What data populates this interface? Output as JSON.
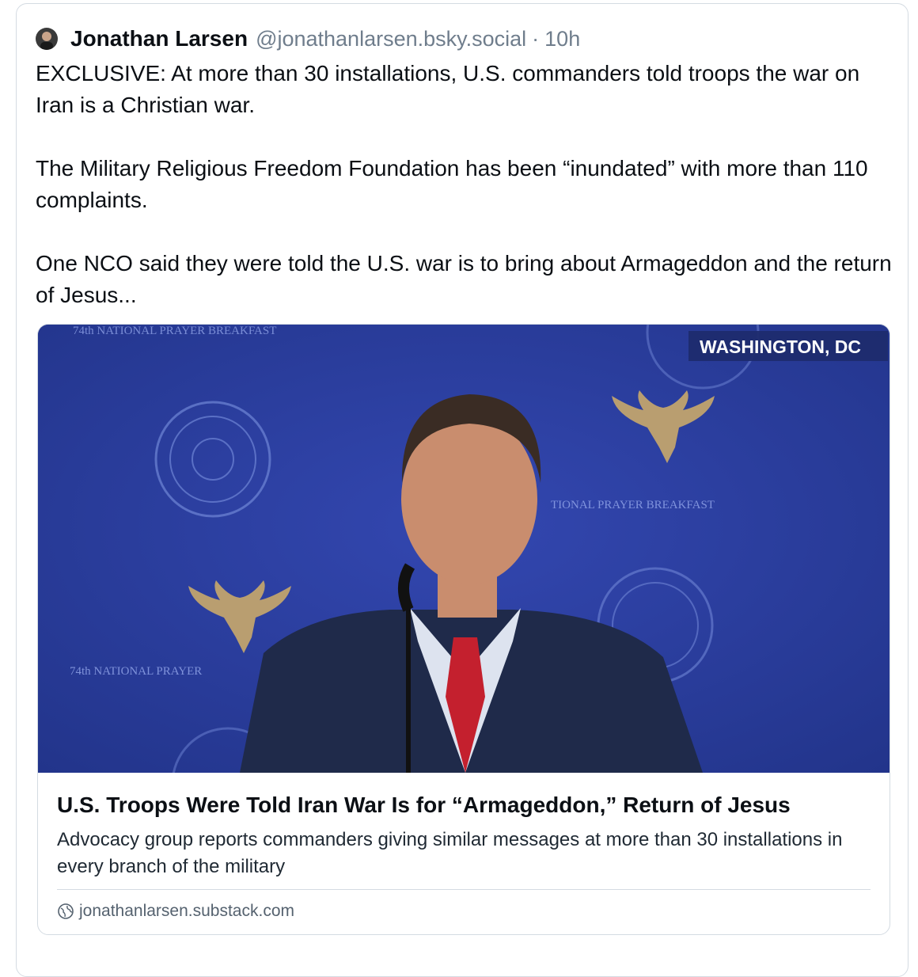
{
  "post": {
    "author": {
      "display_name": "Jonathan Larsen",
      "handle": "@jonathanlarsen.bsky.social",
      "separator": "·",
      "time": "10h",
      "avatar_icon": "avatar-photo"
    },
    "text": {
      "p1": "EXCLUSIVE: At more than 30 installations, U.S. commanders told troops the war on Iran is a Christian war.",
      "p2": "The Military Religious Freedom Foundation has been “inundated” with more than 110 complaints.",
      "p3": "One NCO said they were told the U.S. war is to bring about Armageddon and the return of Jesus..."
    },
    "link_card": {
      "image": {
        "overlay_label": "WASHINGTON, DC",
        "backdrop_text_top": "74th NATIONAL PRAYER BREAKFAST",
        "backdrop_text_mid": "TIONAL PRAYER BREAKFAST",
        "backdrop_text_left": "74th NATIONAL PRAYER"
      },
      "title": "U.S. Troops Were Told Iran War Is for “Armageddon,” Return of Jesus",
      "description": "Advocacy group reports commanders giving similar messages at more than 30 installations in every branch of the military",
      "domain": "jonathanlarsen.substack.com",
      "domain_icon": "globe-icon"
    }
  },
  "colors": {
    "backdrop_blue": "#2a3d9e",
    "overlay_bg": "#1d2b6e",
    "muted_text": "#6f7d8c",
    "border": "#d4dbe2"
  }
}
